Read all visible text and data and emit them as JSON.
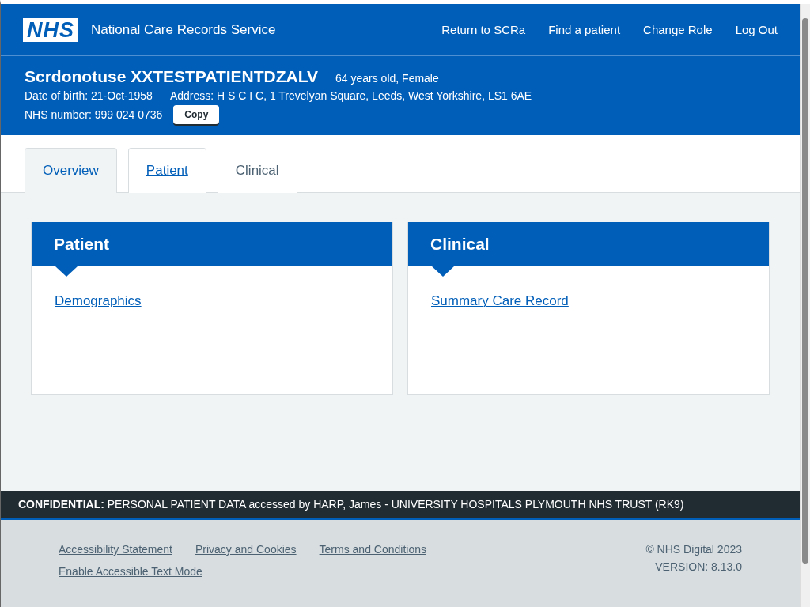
{
  "header": {
    "logo": "NHS",
    "service_name": "National Care Records Service",
    "nav": [
      "Return to SCRa",
      "Find a patient",
      "Change Role",
      "Log Out"
    ]
  },
  "patient": {
    "name": "Scrdonotuse XXTESTPATIENTDZALV",
    "age_sex": "64 years old, Female",
    "dob": "Date of birth: 21-Oct-1958",
    "address": "Address: H S C I C, 1 Trevelyan Square, Leeds, West Yorkshire, LS1 6AE",
    "nhs_number": "NHS number: 999 024 0736",
    "copy_button": "Copy"
  },
  "tabs": [
    {
      "label": "Overview",
      "selected": true,
      "disabled": false
    },
    {
      "label": "Patient",
      "selected": false,
      "disabled": false
    },
    {
      "label": "Clinical",
      "selected": false,
      "disabled": true
    }
  ],
  "cards": [
    {
      "title": "Patient",
      "links": [
        "Demographics"
      ]
    },
    {
      "title": "Clinical",
      "links": [
        "Summary Care Record"
      ]
    }
  ],
  "confidential_banner": "**CONFIDENTIAL:** PERSONAL PATIENT DATA accessed by HARP, James - UNIVERSITY HOSPITALS PLYMOUTH NHS TRUST (RK9)",
  "footer": {
    "links": [
      "Accessibility Statement",
      "Privacy and Cookies",
      "Terms and Conditions",
      "Enable Accessible Text Mode"
    ],
    "copyright": "© NHS Digital 2023",
    "version": "VERSION: 8.13.0"
  }
}
